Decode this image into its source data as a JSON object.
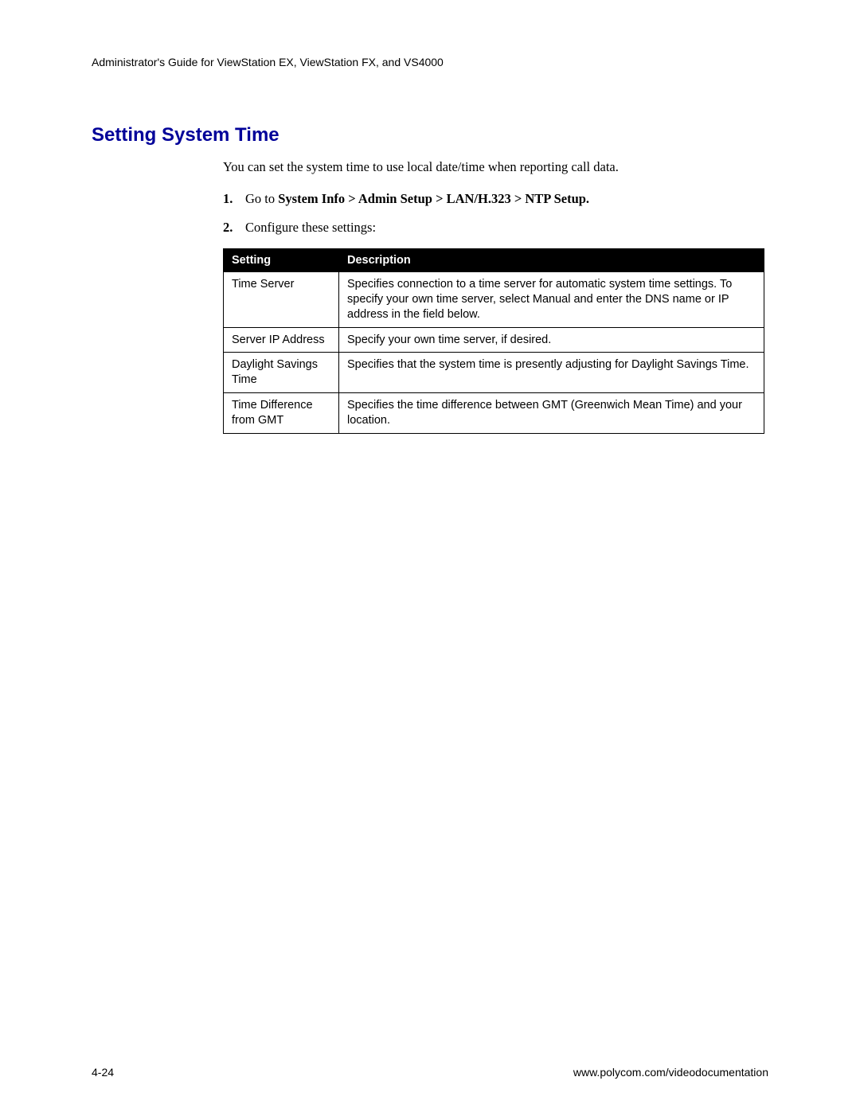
{
  "header": "Administrator's Guide for ViewStation EX, ViewStation FX, and VS4000",
  "heading": "Setting System Time",
  "intro": "You can set the system time to use local date/time when reporting call data.",
  "step1_num": "1.",
  "step1_prefix": "Go to ",
  "step1_bold": "System Info > Admin Setup > LAN/H.323 > NTP Setup.",
  "step2_num": "2.",
  "step2_text": "Configure these settings:",
  "table": {
    "head_setting": "Setting",
    "head_description": "Description",
    "rows": [
      {
        "setting": "Time Server",
        "description": "Specifies connection to a time server for automatic system time settings. To specify your own time server, select Manual and enter the DNS name or IP address in the field below."
      },
      {
        "setting": "Server IP Address",
        "description": "Specify your own time server, if desired."
      },
      {
        "setting": "Daylight Savings Time",
        "description": "Specifies that the system time is presently adjusting for Daylight Savings Time."
      },
      {
        "setting": "Time Difference from GMT",
        "description": "Specifies the time difference between GMT (Greenwich Mean Time) and your location."
      }
    ]
  },
  "footer_left": "4-24",
  "footer_right": "www.polycom.com/videodocumentation"
}
